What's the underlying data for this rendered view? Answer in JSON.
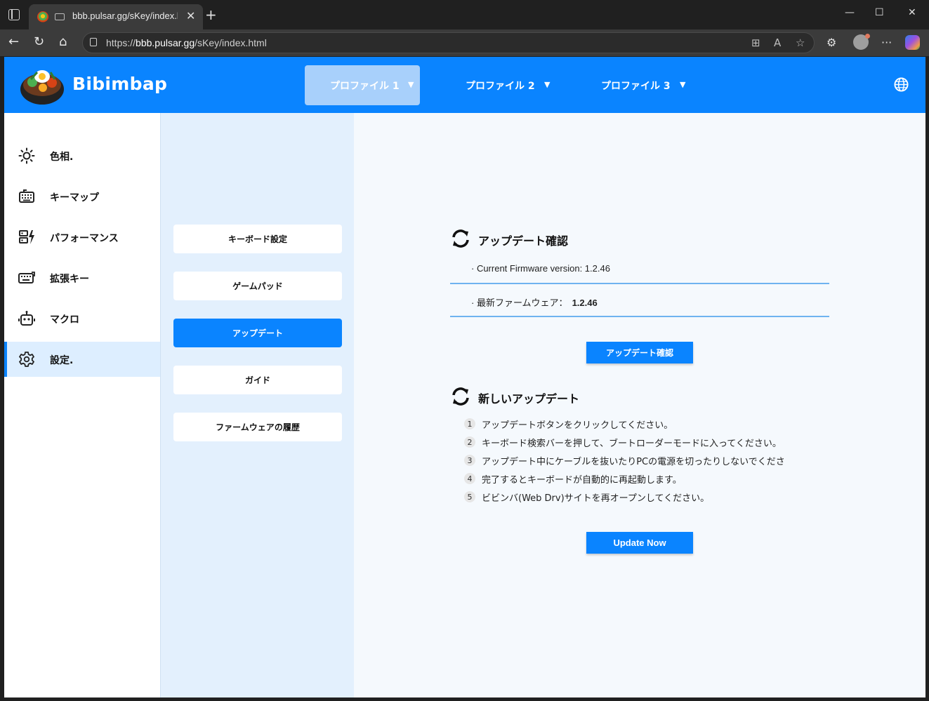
{
  "browser": {
    "tab_title": "bbb.pulsar.gg/sKey/index.htr",
    "url_prefix": "https://",
    "url_host": "bbb.pulsar.gg",
    "url_path": "/sKey/index.html"
  },
  "header": {
    "brand": "Bibimbap",
    "profiles": [
      "プロファイル 1",
      "プロファイル 2",
      "プロファイル 3"
    ]
  },
  "sidebar": {
    "items": [
      {
        "label": "色相.",
        "icon": "sun-icon"
      },
      {
        "label": "キーマップ",
        "icon": "keyboard-icon"
      },
      {
        "label": "パフォーマンス",
        "icon": "performance-icon"
      },
      {
        "label": "拡張キー",
        "icon": "extended-key-icon"
      },
      {
        "label": "マクロ",
        "icon": "robot-icon"
      },
      {
        "label": "設定.",
        "icon": "gear-icon"
      }
    ]
  },
  "subnav": {
    "items": [
      "キーボード設定",
      "ゲームパッド",
      "アップデート",
      "ガイド",
      "ファームウェアの履歴"
    ]
  },
  "update_check": {
    "title": "アップデート確認",
    "current_label": "· Current Firmware version: 1.2.46",
    "latest_label": "· 最新ファームウェア：",
    "latest_value": "1.2.46",
    "button": "アップデート確認"
  },
  "new_update": {
    "title": "新しいアップデート",
    "steps": [
      {
        "num": "1",
        "text": "アップデートボタンをクリックしてください。"
      },
      {
        "num": "2",
        "text": "キーボード検索バーを押して、ブートローダーモードに入ってください。"
      },
      {
        "num": "3",
        "text": "アップデート中にケーブルを抜いたりPCの電源を切ったりしないでくださ"
      },
      {
        "num": "4",
        "text": "完了するとキーボードが自動的に再起動します。"
      },
      {
        "num": "5",
        "text": "ビビンバ(Web Drv)サイトを再オープンしてください。"
      }
    ],
    "button": "Update Now"
  },
  "colors": {
    "accent": "#0a84ff",
    "active_tab": "#a8d0fb",
    "subnav_bg": "#e3f0fd"
  }
}
